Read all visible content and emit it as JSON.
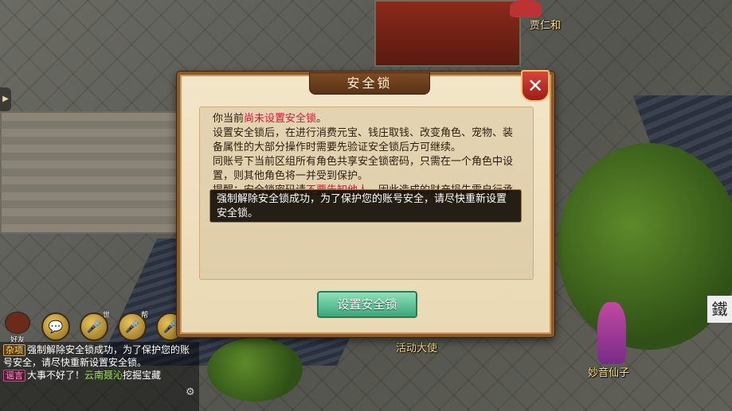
{
  "scene": {
    "npc_names": [
      "贾仁和",
      "活动大使",
      "妙音仙子"
    ],
    "right_sign_text": "鐵"
  },
  "left_tab": {
    "glyph": "▶"
  },
  "chat": {
    "friend_label": "好友",
    "mic_tags": [
      "世",
      "帮",
      "队"
    ],
    "messages": [
      {
        "channel": "杂项",
        "text": "强制解除安全锁成功，为了保护您的账号安全，请尽快重新设置安全锁。"
      },
      {
        "channel": "谣言",
        "text_prefix": "大事不好了！",
        "highlight": "云南聂沁",
        "text_suffix": "挖掘宝藏"
      }
    ]
  },
  "dialog": {
    "title": "安全锁",
    "close_glyph": "✕",
    "line1_prefix": "你当前",
    "line1_status": "尚未设置安全锁",
    "line1_suffix": "。",
    "para2": "设置安全锁后，在进行消费元宝、钱庄取钱、改变角色、宠物、装备属性的大部分操作时需要先验证安全锁后方可继续。",
    "para3": "同账号下当前区组所有角色共享安全锁密码，只需在一个角色中设置，则其他角色将一并受到保护。",
    "para4_prefix": "提醒：安全锁密码请",
    "para4_warn": "不要告知他人",
    "para4_suffix": "，因此造成的财产损失需自行承",
    "tooltip": "强制解除安全锁成功，为了保护您的账号安全，请尽快重新设置安全锁。",
    "button_label": "设置安全锁"
  },
  "colors": {
    "warning_red": "#d8163a",
    "button_green": "#3aa87a",
    "dialog_bg": "#efe1c0"
  }
}
